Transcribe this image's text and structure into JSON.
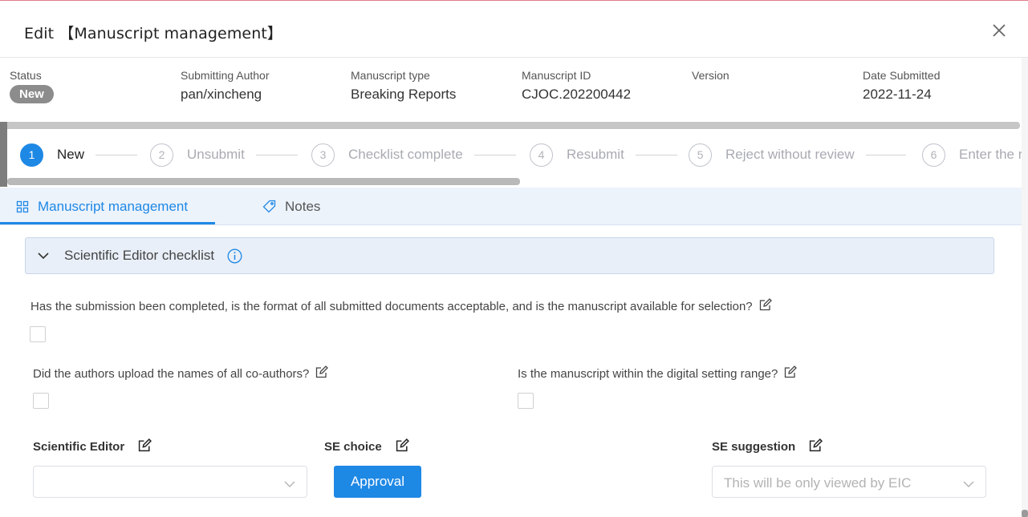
{
  "header": {
    "title": "Edit 【Manuscript management】"
  },
  "info": [
    {
      "label": "Status",
      "value": "New",
      "badge": true
    },
    {
      "label": "Submitting Author",
      "value": "pan/xincheng"
    },
    {
      "label": "Manuscript type",
      "value": "Breaking Reports"
    },
    {
      "label": "Manuscript ID",
      "value": "CJOC.202200442"
    },
    {
      "label": "Version",
      "value": ""
    },
    {
      "label": "Date Submitted",
      "value": "2022-11-24"
    }
  ],
  "steps": [
    {
      "num": "1",
      "label": "New",
      "active": true
    },
    {
      "num": "2",
      "label": "Unsubmit"
    },
    {
      "num": "3",
      "label": "Checklist complete"
    },
    {
      "num": "4",
      "label": "Resubmit"
    },
    {
      "num": "5",
      "label": "Reject without review"
    },
    {
      "num": "6",
      "label": "Enter the re"
    }
  ],
  "tabs": [
    {
      "label": "Manuscript management",
      "active": true
    },
    {
      "label": "Notes"
    }
  ],
  "panel": {
    "title": "Scientific Editor checklist"
  },
  "questions": {
    "q1": "Has the submission been completed, is the format of all submitted documents acceptable, and is the manuscript available for selection?",
    "q2": "Did the authors upload the names of all co-authors?",
    "q3": "Is the manuscript within the digital setting range?"
  },
  "fields": {
    "scientific_editor_label": "Scientific Editor",
    "scientific_editor_value": "",
    "se_choice_label": "SE choice",
    "se_choice_button": "Approval",
    "se_suggestion_label": "SE suggestion",
    "se_suggestion_placeholder": "This will be only viewed by EIC"
  },
  "colors": {
    "accent": "#1e88e5",
    "badge": "#8c8c8c",
    "tab_bg": "#edf3fb"
  }
}
